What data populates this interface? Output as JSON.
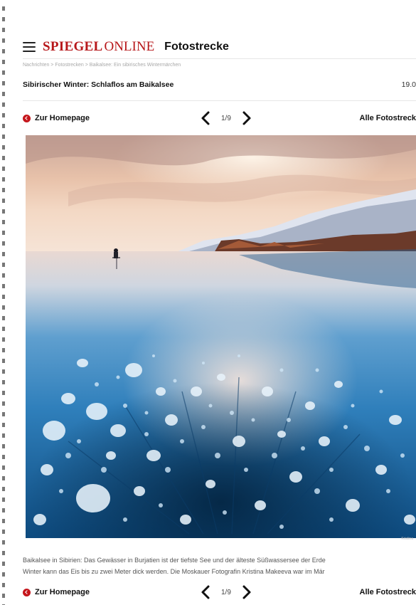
{
  "header": {
    "logo_spiegel": "SPIEGEL",
    "logo_online": "ONLINE",
    "section": "Fotostrecke"
  },
  "breadcrumb": [
    "Nachrichten",
    "Fotostrecken",
    "Baikalsee: Ein sibirisches Wintermärchen"
  ],
  "article": {
    "title": "Sibirischer Winter: Schlaflos am Baikalsee",
    "date": "19.0"
  },
  "nav": {
    "home_label": "Zur Homepage",
    "counter": "1/9",
    "all_label": "Alle Fotostreck"
  },
  "photo": {
    "credit": "Kristina"
  },
  "caption": {
    "line1": "Baikalsee in Sibirien: Das Gewässer in Burjatien ist der tiefste See und der älteste Süßwassersee der Erde",
    "line2": "Winter kann das Eis bis zu zwei Meter dick werden. Die Moskauer Fotografin Kristina Makeeva war im Mär"
  },
  "colors": {
    "brand_red": "#b7171a",
    "home_icon_red": "#c5161c"
  }
}
